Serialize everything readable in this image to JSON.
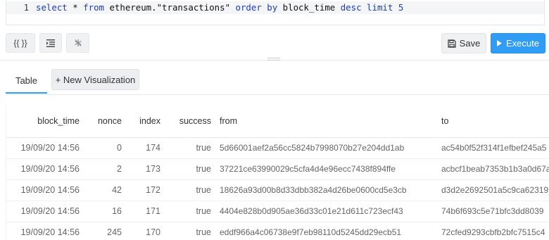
{
  "editor": {
    "line_number": "1",
    "tokens": {
      "t1": "select",
      "t2": " * ",
      "t3": "from",
      "t4": " ethereum.\"transactions\" ",
      "t5": "order by",
      "t6": " block_time ",
      "t7": "desc",
      "t8": " ",
      "t9": "limit",
      "t10": " ",
      "t11": "5"
    }
  },
  "toolbar": {
    "params_label": "{{ }}",
    "save_label": "Save",
    "execute_label": "Execute"
  },
  "tabs": {
    "table_label": "Table",
    "new_vis_label": "+ New Visualization"
  },
  "results": {
    "columns": [
      "block_time",
      "nonce",
      "index",
      "success",
      "from",
      "to"
    ],
    "rows": [
      [
        "19/09/20 14:56",
        "0",
        "174",
        "true",
        "5d66001aef2a56cc5824b7998070b27e204dd1ab",
        "ac54b0f52f314f1efbef245a5"
      ],
      [
        "19/09/20 14:56",
        "2",
        "173",
        "true",
        "37221ce63990029c5cfa4d4e96ecc7438f894ffe",
        "acbcf1beab7353b1b3a0d67a"
      ],
      [
        "19/09/20 14:56",
        "42",
        "172",
        "true",
        "18626a93d00b8d33dbb382a4d26be0600cd5e3cb",
        "d3d2e2692501a5c9ca62319"
      ],
      [
        "19/09/20 14:56",
        "16",
        "171",
        "true",
        "4404e828b0d905ae36d33c01e21d611c723ecf43",
        "74b6f693c5e71bfc3dd8039"
      ],
      [
        "19/09/20 14:56",
        "245",
        "170",
        "true",
        "eddf966a4c06738e9f7eb98110d5245dd29ecb51",
        "72cfed9293cbfb2bfc7515c4"
      ]
    ]
  },
  "colors": {
    "accent": "#2f9cf5",
    "keyword": "#1f3bb3"
  }
}
